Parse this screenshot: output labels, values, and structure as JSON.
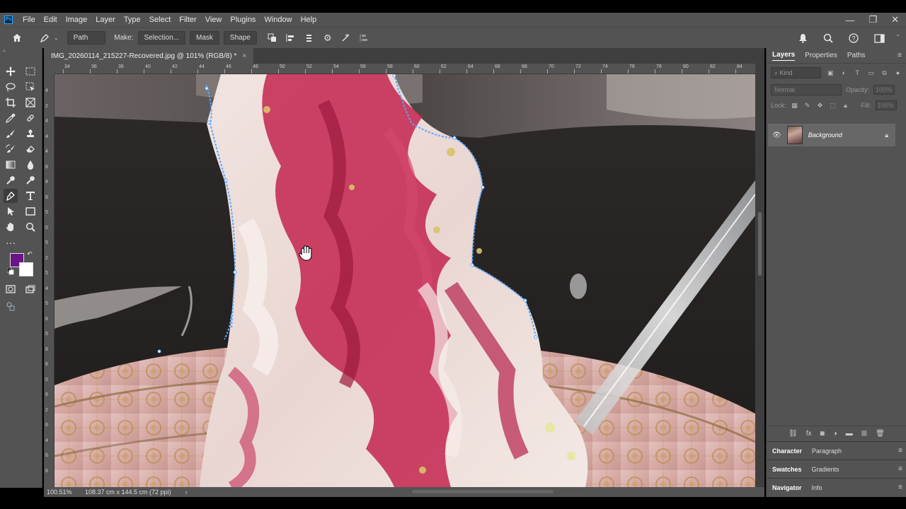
{
  "app": {
    "logo_text": "Ps"
  },
  "menu": [
    "File",
    "Edit",
    "Image",
    "Layer",
    "Type",
    "Select",
    "Filter",
    "View",
    "Plugins",
    "Window",
    "Help"
  ],
  "window_controls": {
    "minimize": "—",
    "restore": "❐",
    "close": "✕"
  },
  "options_bar": {
    "mode_value": "Path",
    "make_label": "Make:",
    "selection_button": "Selection...",
    "mask_button": "Mask",
    "shape_button": "Shape"
  },
  "document": {
    "tab_title": "IMG_20260114_215227-Recovered.jpg @ 101% (RGB/8) *",
    "tab_close": "×"
  },
  "rulers": {
    "top": [
      "34",
      "36",
      "38",
      "40",
      "42",
      "44",
      "46",
      "48",
      "50",
      "52",
      "54",
      "56",
      "58",
      "60",
      "62",
      "64",
      "66",
      "68",
      "70",
      "72",
      "74",
      "76",
      "78",
      "80",
      "82",
      "84"
    ],
    "left": [
      "4",
      "2",
      "4",
      "4",
      "4",
      "6",
      "4",
      "8",
      "5",
      "0",
      "5",
      "2",
      "5",
      "4",
      "5",
      "6",
      "5",
      "8",
      "6",
      "0",
      "6",
      "2",
      "6",
      "4",
      "6",
      "6"
    ]
  },
  "status": {
    "zoom": "100.51%",
    "doc_size": "108.37 cm x 144.5 cm (72 ppi)",
    "arrow": "›"
  },
  "layers_panel": {
    "tabs": [
      "Layers",
      "Properties",
      "Paths"
    ],
    "active_tab": "Layers",
    "kind_placeholder": "Kind",
    "blend_mode": "Normal",
    "opacity_label": "Opacity:",
    "opacity_value": "100%",
    "lock_label": "Lock:",
    "fill_label": "Fill:",
    "fill_value": "100%",
    "layers": [
      {
        "name": "Background",
        "visible": true,
        "locked": true
      }
    ]
  },
  "collapsed_panels": [
    {
      "tabs": [
        "Character",
        "Paragraph"
      ]
    },
    {
      "tabs": [
        "Swatches",
        "Gradients"
      ]
    },
    {
      "tabs": [
        "Navigator",
        "Info"
      ]
    }
  ],
  "colors": {
    "foreground": "#6a1488",
    "background": "#ffffff",
    "path_outline": "#58a8ff"
  },
  "icons": {
    "toolbar": [
      "move-icon",
      "marquee-icon",
      "lasso-icon",
      "object-select-icon",
      "crop-icon",
      "frame-icon",
      "eyedropper-icon",
      "healing-brush-icon",
      "brush-icon",
      "stamp-icon",
      "history-brush-icon",
      "eraser-icon",
      "gradient-icon",
      "blur-icon",
      "dodge-icon",
      "pen-icon",
      "type-icon",
      "path-select-icon",
      "rectangle-icon",
      "hand-icon",
      "zoom-icon",
      "more-tools-icon",
      "quick-mask-icon",
      "screen-mode-icon"
    ]
  }
}
